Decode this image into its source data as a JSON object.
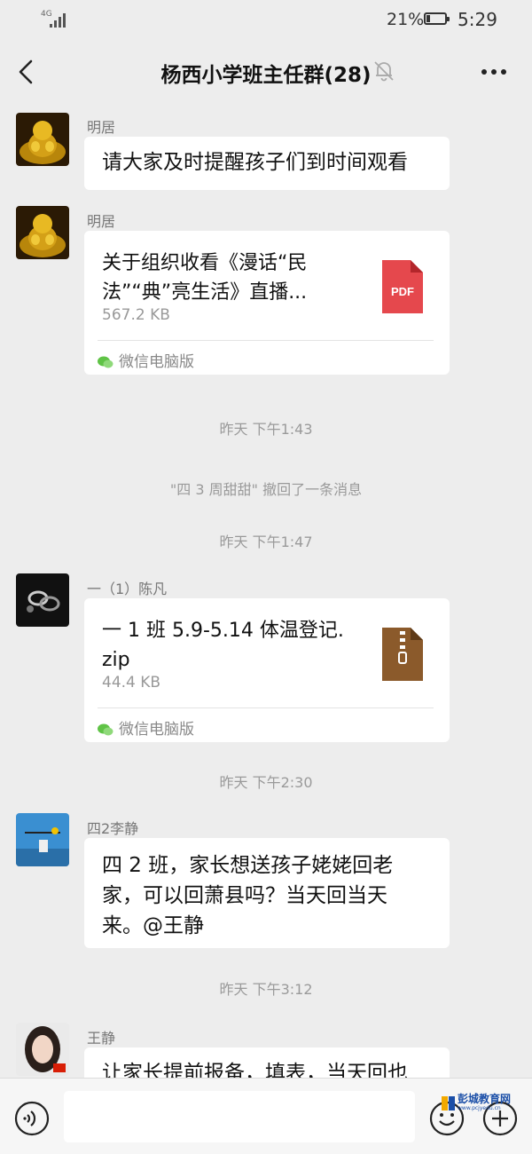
{
  "status_bar": {
    "network": "4G",
    "battery_percent": "21%",
    "battery_level": 0.21,
    "time": "5:29"
  },
  "header": {
    "title": "杨西小学班主任群(28)",
    "muted": true
  },
  "messages": [
    {
      "type": "text",
      "sender": "明居",
      "avatar": "golden-buddha-avatar",
      "text": "请大家及时提醒孩子们到时间观看"
    },
    {
      "type": "file",
      "sender": "明居",
      "avatar": "golden-buddha-avatar",
      "file_name_line1": "关于组织收看《漫话“民",
      "file_name_line2": "法”“典”亮生活》直播...",
      "file_size": "567.2 KB",
      "file_type": "PDF",
      "source": "微信电脑版"
    },
    {
      "type": "system",
      "text": "昨天 下午1:43"
    },
    {
      "type": "system",
      "text": "\"四 3 周甜甜\" 撤回了一条消息"
    },
    {
      "type": "system",
      "text": "昨天 下午1:47"
    },
    {
      "type": "file",
      "sender": "一（1）陈凡",
      "avatar": "chain-avatar",
      "file_name_line1": "一 1 班 5.9-5.14 体温登记.",
      "file_name_line2": "zip",
      "file_size": "44.4 KB",
      "file_type": "ZIP",
      "source": "微信电脑版"
    },
    {
      "type": "system",
      "text": "昨天 下午2:30"
    },
    {
      "type": "text",
      "sender": "四2李静",
      "avatar": "blue-scene-avatar",
      "text_lines": [
        "四 2 班，家长想送孩子姥姥回老",
        "家，可以回萧县吗？当天回当天",
        "来。@王静"
      ]
    },
    {
      "type": "system",
      "text": "昨天 下午3:12"
    },
    {
      "type": "text",
      "sender": "王静",
      "avatar": "woman-photo-avatar",
      "text": "让家长提前报备，填表，当天回也"
    }
  ],
  "input_bar": {
    "voice_icon": "voice-icon",
    "emoji_icon": "emoji-icon",
    "plus_icon": "plus-icon"
  },
  "watermark": {
    "text": "彭城教育网",
    "url": "www.pcjyedu.cn"
  },
  "colors": {
    "background": "#ededed",
    "bubble": "#ffffff",
    "pdf_red": "#e5484d",
    "zip_brown": "#8b5a2b",
    "wechat_green": "#5fc346"
  }
}
